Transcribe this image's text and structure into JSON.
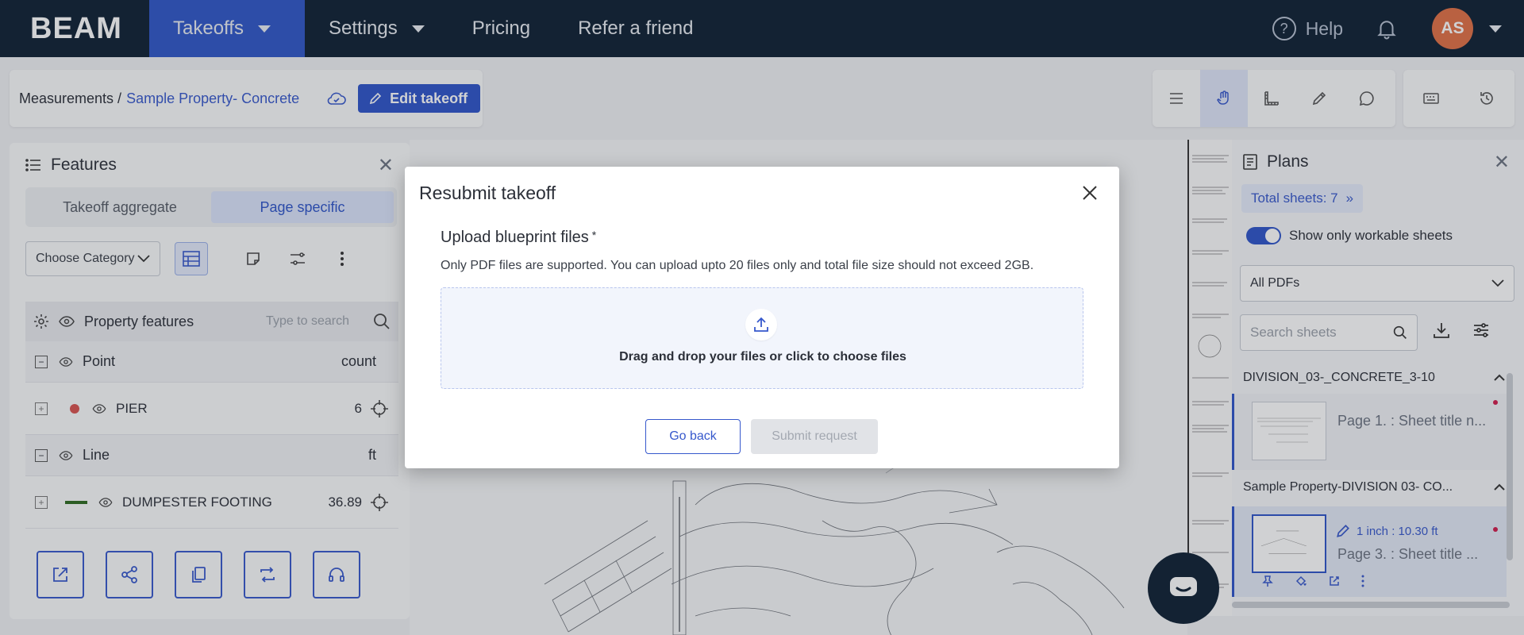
{
  "nav": {
    "logo": "BEAM",
    "items": [
      {
        "label": "Takeoffs",
        "active": true,
        "dropdown": true
      },
      {
        "label": "Settings",
        "active": false,
        "dropdown": true
      },
      {
        "label": "Pricing",
        "active": false,
        "dropdown": false
      },
      {
        "label": "Refer a friend",
        "active": false,
        "dropdown": false
      }
    ],
    "help": "Help",
    "avatar_initials": "AS",
    "brand_color": "#0d1f33",
    "accent_color": "#2f56c8",
    "avatar_color": "#e27045"
  },
  "breadcrumb": {
    "root": "Measurements /",
    "current": "Sample Property- Concrete",
    "edit_button": "Edit takeoff"
  },
  "toolbar": {
    "icons": [
      "list-icon",
      "hand-pan-icon",
      "ruler-icon",
      "pencil-icon",
      "comment-icon",
      "keyboard-icon",
      "history-icon"
    ],
    "active": "hand-pan-icon"
  },
  "features": {
    "title": "Features",
    "tabs": [
      "Takeoff aggregate",
      "Page specific"
    ],
    "active_tab": "Page specific",
    "category_placeholder": "Choose Category",
    "table": {
      "header": "Property features",
      "search_placeholder": "Type to search",
      "groups": [
        {
          "name": "Point",
          "unit": "count",
          "rows": [
            {
              "name": "PIER",
              "value": "6",
              "color": "#d9534f"
            }
          ]
        },
        {
          "name": "Line",
          "unit": "ft",
          "rows": [
            {
              "name": "DUMPESTER FOOTING",
              "value": "36.89",
              "color": "#2e6b1f"
            }
          ]
        }
      ]
    },
    "bottom_actions": [
      "open-external-icon",
      "share-icon",
      "copy-icon",
      "swap-icon",
      "support-icon"
    ]
  },
  "plans": {
    "title": "Plans",
    "total_sheets": "Total sheets: 7",
    "toggle_label": "Show only workable sheets",
    "toggle_on": true,
    "pdf_filter": "All PDFs",
    "search_placeholder": "Search sheets",
    "divisions": [
      {
        "name": "DIVISION_03-_CONCRETE_3-10",
        "sheet": "Page 1.  : Sheet title n...",
        "scale": ""
      },
      {
        "name": "Sample Property-DIVISION 03- CO...",
        "sheet": "Page 3.  : Sheet title ...",
        "scale": "1 inch : 10.30 ft"
      }
    ]
  },
  "modal": {
    "title": "Resubmit takeoff",
    "upload_label": "Upload blueprint files",
    "required_mark": "*",
    "hint": "Only PDF files are supported. You can upload upto 20 files only and total file size should not exceed 2GB.",
    "dropzone_text": "Drag and drop your files or click to choose files",
    "back_button": "Go back",
    "submit_button": "Submit request",
    "submit_enabled": false
  }
}
